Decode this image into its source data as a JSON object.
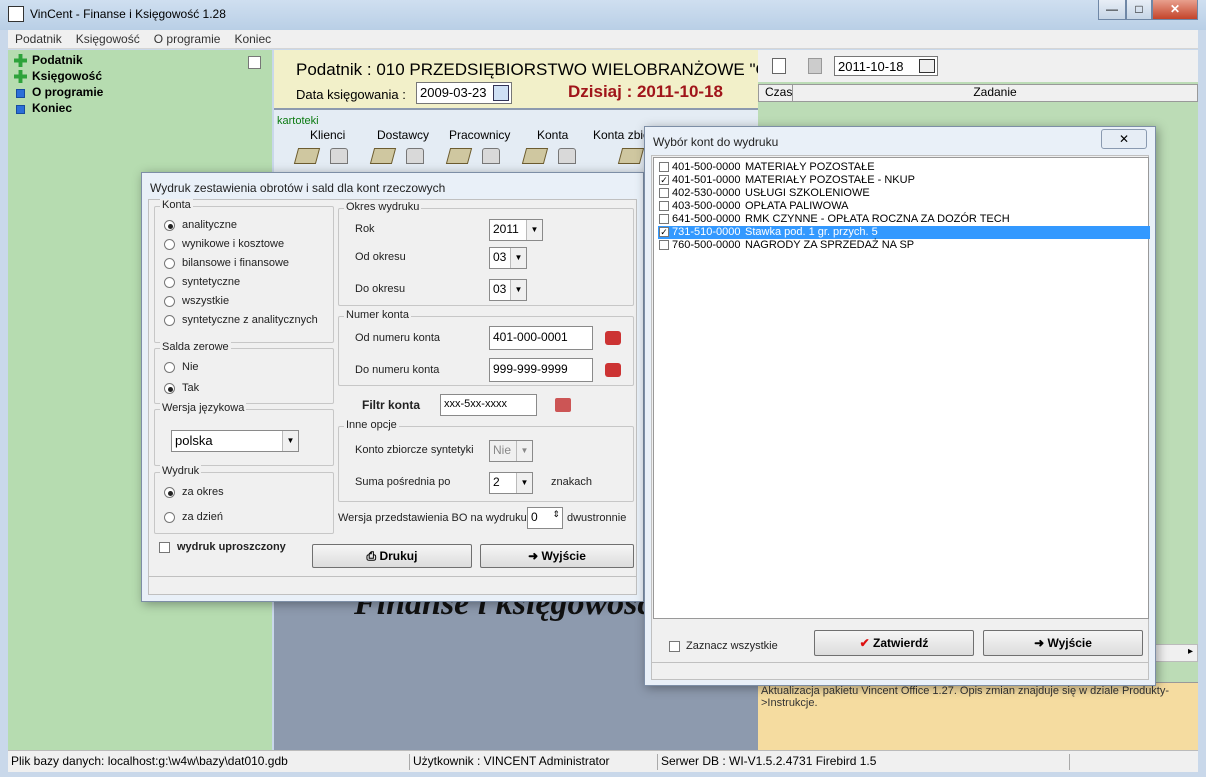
{
  "app": {
    "title": "VinCent - Finanse i Księgowość 1.28"
  },
  "menu": [
    "Podatnik",
    "Księgowość",
    "O programie",
    "Koniec"
  ],
  "nav": [
    "Podatnik",
    "Księgowość",
    "O programie",
    "Koniec"
  ],
  "header": {
    "podatnik": "Podatnik : 010 PRZEDSIĘBIORSTWO WIELOBRANŻOWE \"GA",
    "data_label": "Data księgowania :",
    "data_value": "2009-03-23",
    "dzisiaj": "Dzisiaj : 2011-10-18"
  },
  "kartoteki": {
    "label": "kartoteki",
    "tabs": [
      "Klienci",
      "Dostawcy",
      "Pracownicy",
      "Konta",
      "Konta zbio"
    ]
  },
  "background_title": "Finanse i księgowość",
  "right": {
    "date": "2011-10-18",
    "col_czas": "Czas",
    "col_zadanie": "Zadanie",
    "note": "Aktualizacja pakietu Vincent Office 1.27. Opis zmian znajduje się w dziale Produkty->Instrukcje."
  },
  "status": {
    "db_file": "Plik bazy danych: localhost:g:\\w4w\\bazy\\dat010.gdb",
    "user": "Użytkownik : VINCENT Administrator",
    "server": "Serwer DB : WI-V1.5.2.4731 Firebird 1.5"
  },
  "report_dialog": {
    "title": "Wydruk zestawienia obrotów i sald dla kont rzeczowych",
    "konta": {
      "legend": "Konta",
      "options": [
        "analityczne",
        "wynikowe i kosztowe",
        "bilansowe i finansowe",
        "syntetyczne",
        "wszystkie",
        "syntetyczne z analitycznych"
      ],
      "selected": "analityczne"
    },
    "salda": {
      "legend": "Salda zerowe",
      "options": [
        "Nie",
        "Tak"
      ],
      "selected": "Tak"
    },
    "wersja": {
      "legend": "Wersja językowa",
      "value": "polska"
    },
    "wydruk": {
      "legend": "Wydruk",
      "options": [
        "za okres",
        "za dzień"
      ],
      "selected": "za okres"
    },
    "uproszczony_label": "wydruk uproszczony",
    "okres": {
      "legend": "Okres wydruku",
      "rok_label": "Rok",
      "rok_value": "2011",
      "od_label": "Od okresu",
      "od_value": "03",
      "do_label": "Do okresu",
      "do_value": "03"
    },
    "numer": {
      "legend": "Numer konta",
      "od_label": "Od numeru konta",
      "od_value": "401-000-0001",
      "do_label": "Do numeru konta",
      "do_value": "999-999-9999"
    },
    "filtr": {
      "label": "Filtr konta",
      "value": "xxx-5xx-xxxx"
    },
    "inne": {
      "legend": "Inne opcje",
      "zbiorcze_label": "Konto zbiorcze syntetyki",
      "zbiorcze_value": "Nie",
      "suma_label": "Suma pośrednia po",
      "suma_value": "2",
      "suma_suffix": "znakach"
    },
    "bo": {
      "label": "Wersja przedstawienia BO na wydruku",
      "value": "0",
      "suffix": "dwustronnie"
    },
    "print_button": "Drukuj",
    "exit_button": "Wyjście"
  },
  "accounts_dialog": {
    "title": "Wybór kont do wydruku",
    "rows": [
      {
        "code": "401-500-0000",
        "name": "MATERIAŁY POZOSTAŁE",
        "checked": false,
        "selected": false
      },
      {
        "code": "401-501-0000",
        "name": "MATERIAŁY POZOSTAŁE - NKUP",
        "checked": true,
        "selected": false
      },
      {
        "code": "402-530-0000",
        "name": "USŁUGI SZKOLENIOWE",
        "checked": false,
        "selected": false
      },
      {
        "code": "403-500-0000",
        "name": "OPŁATA PALIWOWA",
        "checked": false,
        "selected": false
      },
      {
        "code": "641-500-0000",
        "name": "RMK CZYNNE - OPŁATA ROCZNA ZA DOZÓR TECH",
        "checked": false,
        "selected": false
      },
      {
        "code": "731-510-0000",
        "name": "Stawka pod. 1 gr. przych. 5",
        "checked": true,
        "selected": true
      },
      {
        "code": "760-500-0000",
        "name": "NAGRODY ZA SPRZEDAŻ NA SP",
        "checked": false,
        "selected": false
      }
    ],
    "select_all_label": "Zaznacz wszystkie",
    "confirm_button": "Zatwierdź",
    "exit_button": "Wyjście"
  },
  "colors": {
    "selection": "#3399ff",
    "dzisiaj": "#a0151a",
    "left_panel": "#b6dcb0",
    "header_bg": "#f2f0c9"
  }
}
